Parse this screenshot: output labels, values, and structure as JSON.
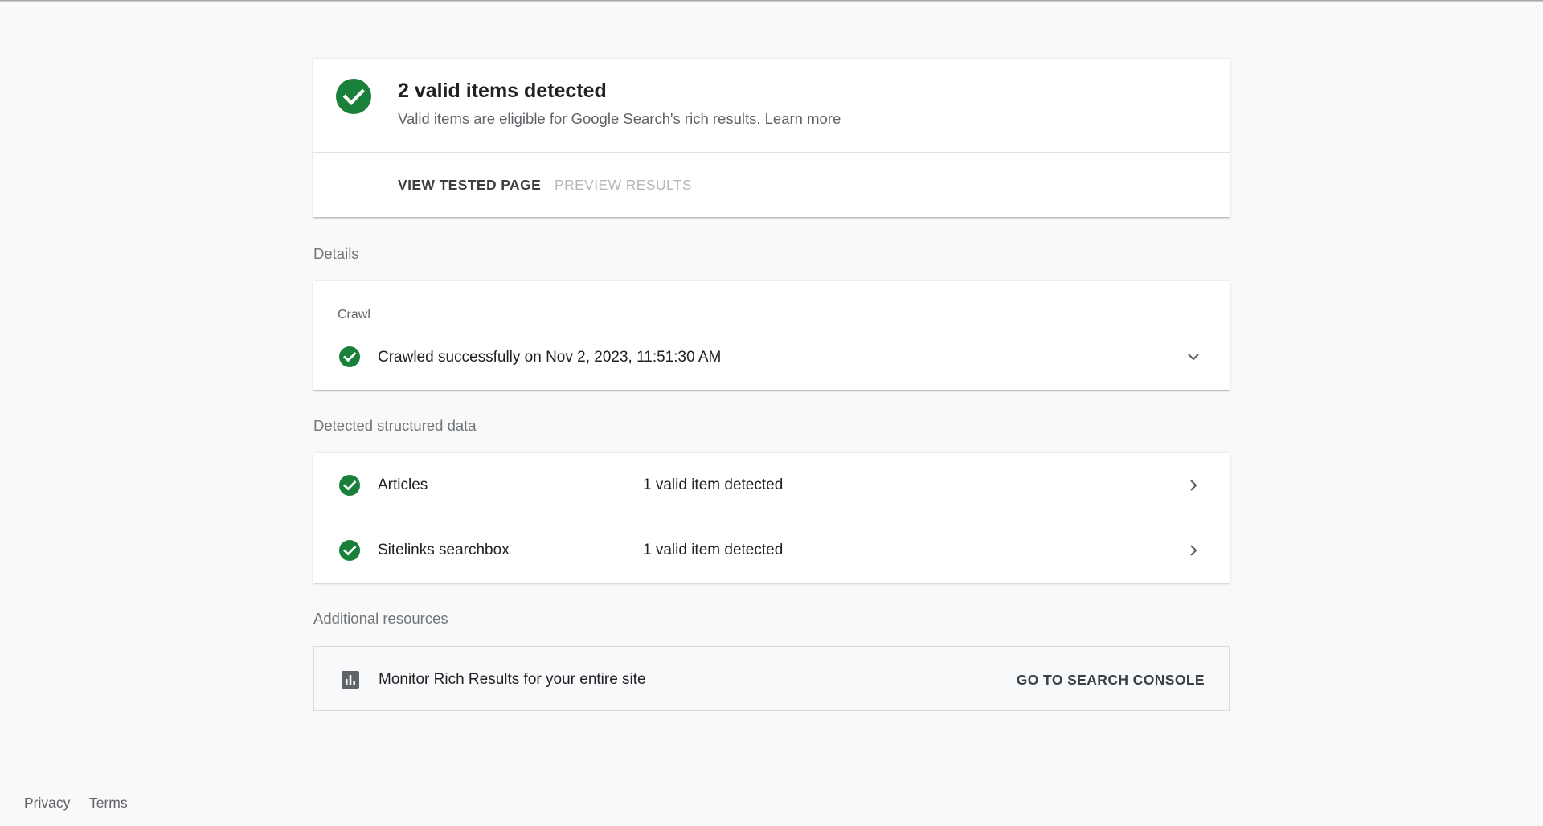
{
  "summary": {
    "title": "2 valid items detected",
    "subtitle": "Valid items are eligible for Google Search's rich results.",
    "learn_more": "Learn more",
    "view_tested_page": "VIEW TESTED PAGE",
    "preview_results": "PREVIEW RESULTS",
    "status_icon": "check-circle-icon",
    "status_color": "#188038"
  },
  "details": {
    "section_label": "Details",
    "crawl_caption": "Crawl",
    "crawl_status": "Crawled successfully on Nov 2, 2023, 11:51:30 AM",
    "expand_icon": "chevron-down-icon"
  },
  "structured_data": {
    "section_label": "Detected structured data",
    "items": [
      {
        "name": "Articles",
        "status": "1 valid item detected"
      },
      {
        "name": "Sitelinks searchbox",
        "status": "1 valid item detected"
      }
    ],
    "row_icon": "chevron-right-icon"
  },
  "resources": {
    "section_label": "Additional resources",
    "text": "Monitor Rich Results for your entire site",
    "button": "GO TO SEARCH CONSOLE",
    "icon": "bar-chart-icon"
  },
  "footer": {
    "privacy": "Privacy",
    "terms": "Terms"
  },
  "colors": {
    "background": "#f9f9f9",
    "success": "#188038",
    "text_primary": "#202124",
    "text_secondary": "#5f6368",
    "disabled": "#b5b7ba"
  }
}
